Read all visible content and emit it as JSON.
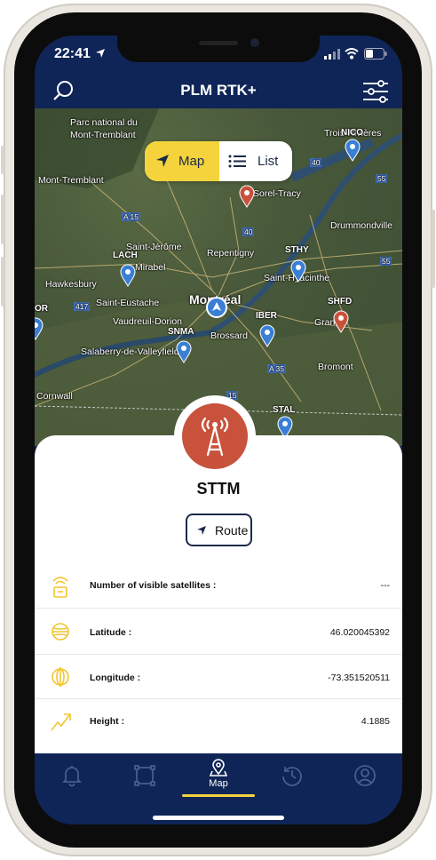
{
  "status_bar": {
    "time": "22:41"
  },
  "header": {
    "title": "PLM RTK+"
  },
  "view_toggle": {
    "map_label": "Map",
    "list_label": "List"
  },
  "map": {
    "places": [
      "Parc national du",
      "Mont-Tremblant",
      "Trois-Rivières",
      "Mont-Tremblant",
      "Sorel-Tracy",
      "Drummondville",
      "Saint-Jérôme",
      "Repentigny",
      "Mirabel",
      "Hawkesbury",
      "Saint-Eustache",
      "Montréal",
      "Saint-Hyacinthe",
      "Vaudreuil-Dorion",
      "Brossard",
      "Granby",
      "Salaberry-de-Valleyfield",
      "Bromont",
      "Cornwall"
    ],
    "stations": [
      "NICO",
      "LACH",
      "STHY",
      "SHFD",
      "IBER",
      "SNMA",
      "STAL",
      "OR"
    ],
    "roads": [
      "A 15",
      "40",
      "40",
      "55",
      "55",
      "417",
      "A 35",
      "15"
    ]
  },
  "detail": {
    "station_name": "STTM",
    "route_label": "Route",
    "rows": [
      {
        "label": "Number of visible satellites :",
        "value": "---"
      },
      {
        "label": "Latitude :",
        "value": "46.020045392"
      },
      {
        "label": "Longitude :",
        "value": "-73.351520511"
      },
      {
        "label": "Height :",
        "value": "4.1885"
      }
    ]
  },
  "tabbar": {
    "active_label": "Map"
  },
  "colors": {
    "navy": "#0f2557",
    "accent_yellow": "#f4d33c",
    "station_red": "#c8523c",
    "marker_blue": "#3a7fd5"
  }
}
